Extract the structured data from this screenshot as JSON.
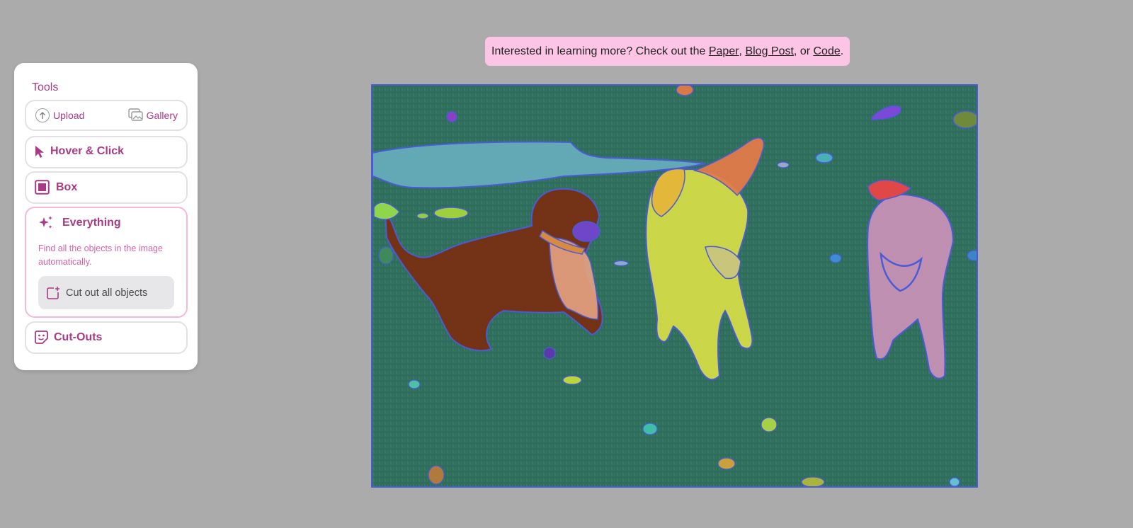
{
  "banner": {
    "prefix": "Interested in learning more? Check out the ",
    "paper": "Paper",
    "sep1": ", ",
    "blog": "Blog Post",
    "sep2": ", or ",
    "code": "Code",
    "suffix": "."
  },
  "tools": {
    "title": "Tools",
    "upload_label": "Upload",
    "gallery_label": "Gallery",
    "hover_label": "Hover & Click",
    "box_label": "Box",
    "everything_label": "Everything",
    "everything_desc": "Find all the objects in the image automatically.",
    "cut_all_label": "Cut out all objects",
    "cutouts_label": "Cut-Outs"
  },
  "icons": {
    "upload": "arrow-up-circle-icon",
    "gallery": "gallery-icon",
    "hover": "cursor-pointer-icon",
    "box": "box-square-icon",
    "everything": "sparkles-icon",
    "cut_all": "add-cutout-icon",
    "cutouts": "sticker-icon"
  },
  "colors": {
    "brand": "#a83a86",
    "active_border": "#f6b7d9",
    "banner_bg": "#fcc4e5",
    "mask_outline": "#4b5bd6"
  }
}
